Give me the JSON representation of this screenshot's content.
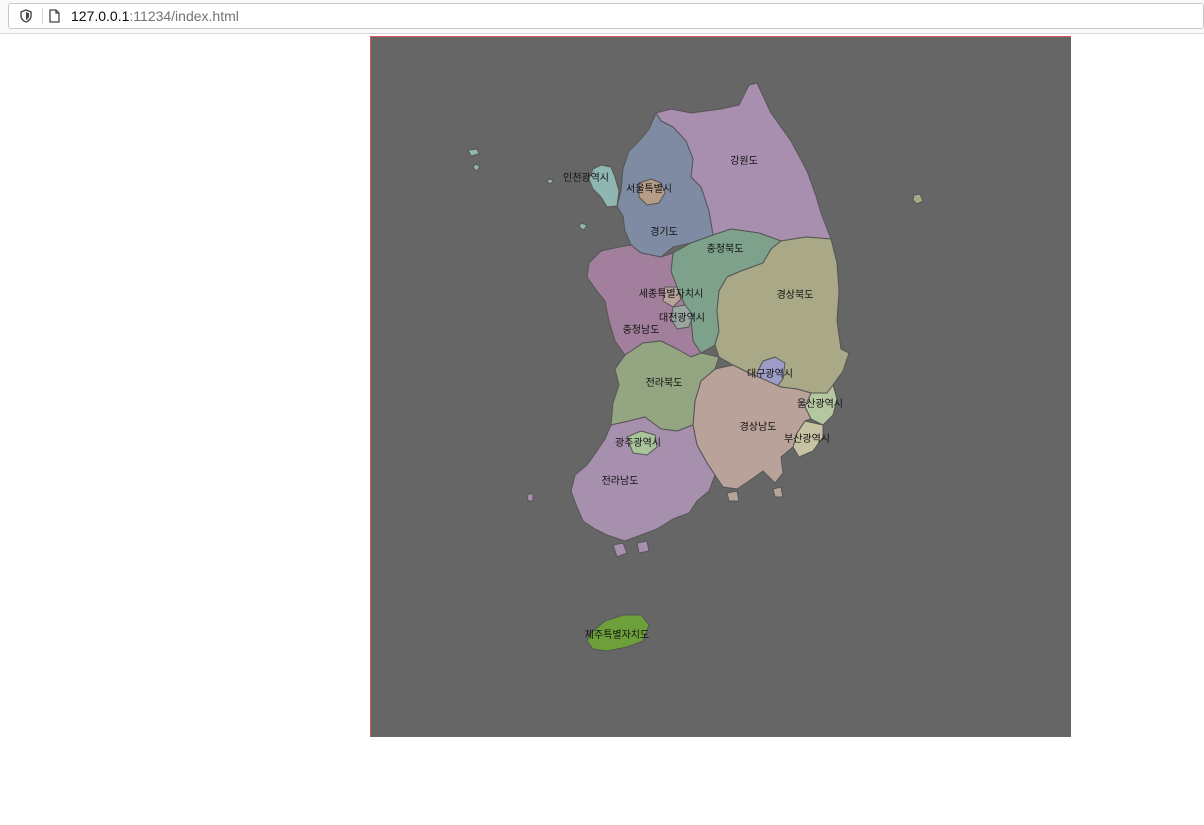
{
  "browser": {
    "url_host": "127.0.0.1",
    "url_rest": ":11234/index.html",
    "icons": [
      "shield-icon",
      "page-icon"
    ]
  },
  "map": {
    "background": "#666666",
    "regions": [
      {
        "id": "gangwon",
        "name": "강원도",
        "color": "#a88faf"
      },
      {
        "id": "gyeonggi",
        "name": "경기도",
        "color": "#7f8aa3"
      },
      {
        "id": "seoul",
        "name": "서울특별시",
        "color": "#b49c86"
      },
      {
        "id": "incheon",
        "name": "인천광역시",
        "color": "#8fb6b1"
      },
      {
        "id": "chungbuk",
        "name": "충청북도",
        "color": "#7ea18b"
      },
      {
        "id": "chungnam",
        "name": "충청남도",
        "color": "#a27f9c"
      },
      {
        "id": "sejong",
        "name": "세종특별자치시",
        "color": "#b8a29a"
      },
      {
        "id": "daejeon",
        "name": "대전광역시",
        "color": "#9aa6a0"
      },
      {
        "id": "gyeongbuk",
        "name": "경상북도",
        "color": "#a9a887"
      },
      {
        "id": "daegu",
        "name": "대구광역시",
        "color": "#9c9cc6"
      },
      {
        "id": "ulsan",
        "name": "울산광역시",
        "color": "#b5c7a0"
      },
      {
        "id": "busan",
        "name": "부산광역시",
        "color": "#c7c3a2"
      },
      {
        "id": "gyeongnam",
        "name": "경상남도",
        "color": "#b8a29a"
      },
      {
        "id": "jeonbuk",
        "name": "전라북도",
        "color": "#94a581"
      },
      {
        "id": "gwangju",
        "name": "광주광역시",
        "color": "#a9c49a"
      },
      {
        "id": "jeonnam",
        "name": "전라남도",
        "color": "#a78fae"
      },
      {
        "id": "jeju",
        "name": "제주특별자치도",
        "color": "#6da03a"
      }
    ]
  }
}
